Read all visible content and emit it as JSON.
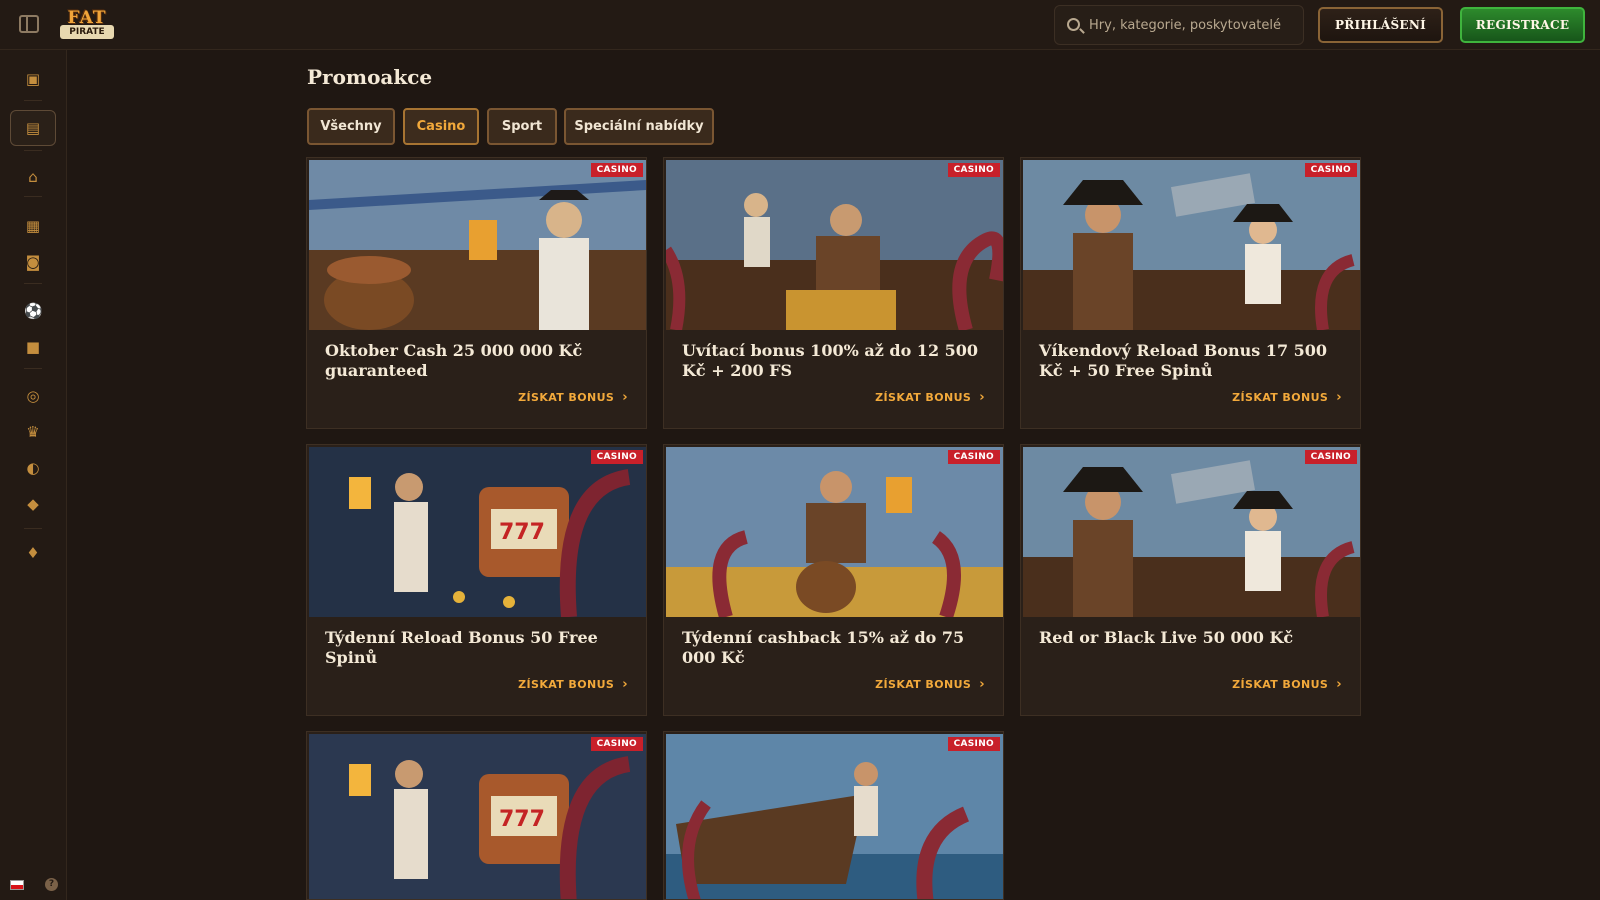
{
  "header": {
    "logo_top": "FAT",
    "logo_bottom": "PIRATE",
    "search_placeholder": "Hry, kategorie, poskytovatelé",
    "login_label": "PŘIHLÁŠENÍ",
    "register_label": "REGISTRACE"
  },
  "sidebar": {
    "items": [
      {
        "icon": "treasure-chest-icon",
        "glyph": "▣"
      },
      {
        "icon": "promotions-chest-icon",
        "glyph": "▤",
        "active": true
      },
      {
        "icon": "home-icon",
        "glyph": "⌂"
      },
      {
        "icon": "calendar-icon",
        "glyph": "▦"
      },
      {
        "icon": "cards-icon",
        "glyph": "◙"
      },
      {
        "icon": "soccer-ball-icon",
        "glyph": "⚽"
      },
      {
        "icon": "live-icon",
        "glyph": "■"
      },
      {
        "icon": "award-badge-icon",
        "glyph": "◎"
      },
      {
        "icon": "trophy-icon",
        "glyph": "♛"
      },
      {
        "icon": "vip-icon",
        "glyph": "◐"
      },
      {
        "icon": "shop-bag-icon",
        "glyph": "◆"
      },
      {
        "icon": "diamond-icon",
        "glyph": "♦"
      }
    ],
    "help_glyph": "?"
  },
  "main": {
    "title": "Promoakce",
    "filters": [
      {
        "label": "Všechny",
        "active": false
      },
      {
        "label": "Casino",
        "active": true
      },
      {
        "label": "Sport",
        "active": false
      },
      {
        "label": "Speciální nabídky",
        "active": false
      }
    ],
    "cards": [
      {
        "badge": "CASINO",
        "title": "Oktober Cash 25 000 000 Kč guaranteed",
        "cta": "ZÍSKAT BONUS"
      },
      {
        "badge": "CASINO",
        "title": "Uvítací bonus 100% až do 12 500 Kč + 200 FS",
        "cta": "ZÍSKAT BONUS"
      },
      {
        "badge": "CASINO",
        "title": "Víkendový Reload Bonus 17 500 Kč + 50 Free Spinů",
        "cta": "ZÍSKAT BONUS"
      },
      {
        "badge": "CASINO",
        "title": "Týdenní Reload Bonus 50 Free Spinů",
        "cta": "ZÍSKAT BONUS"
      },
      {
        "badge": "CASINO",
        "title": "Týdenní cashback 15% až do 75 000 Kč",
        "cta": "ZÍSKAT BONUS"
      },
      {
        "badge": "CASINO",
        "title": "Red or Black Live 50 000 Kč",
        "cta": "ZÍSKAT BONUS"
      },
      {
        "badge": "CASINO",
        "title": "",
        "cta": ""
      },
      {
        "badge": "CASINO",
        "title": "",
        "cta": ""
      }
    ]
  },
  "colors": {
    "background": "#1f1712",
    "accent": "#f2a93b",
    "badge": "#c8202a",
    "register": "#2d8a2c"
  }
}
